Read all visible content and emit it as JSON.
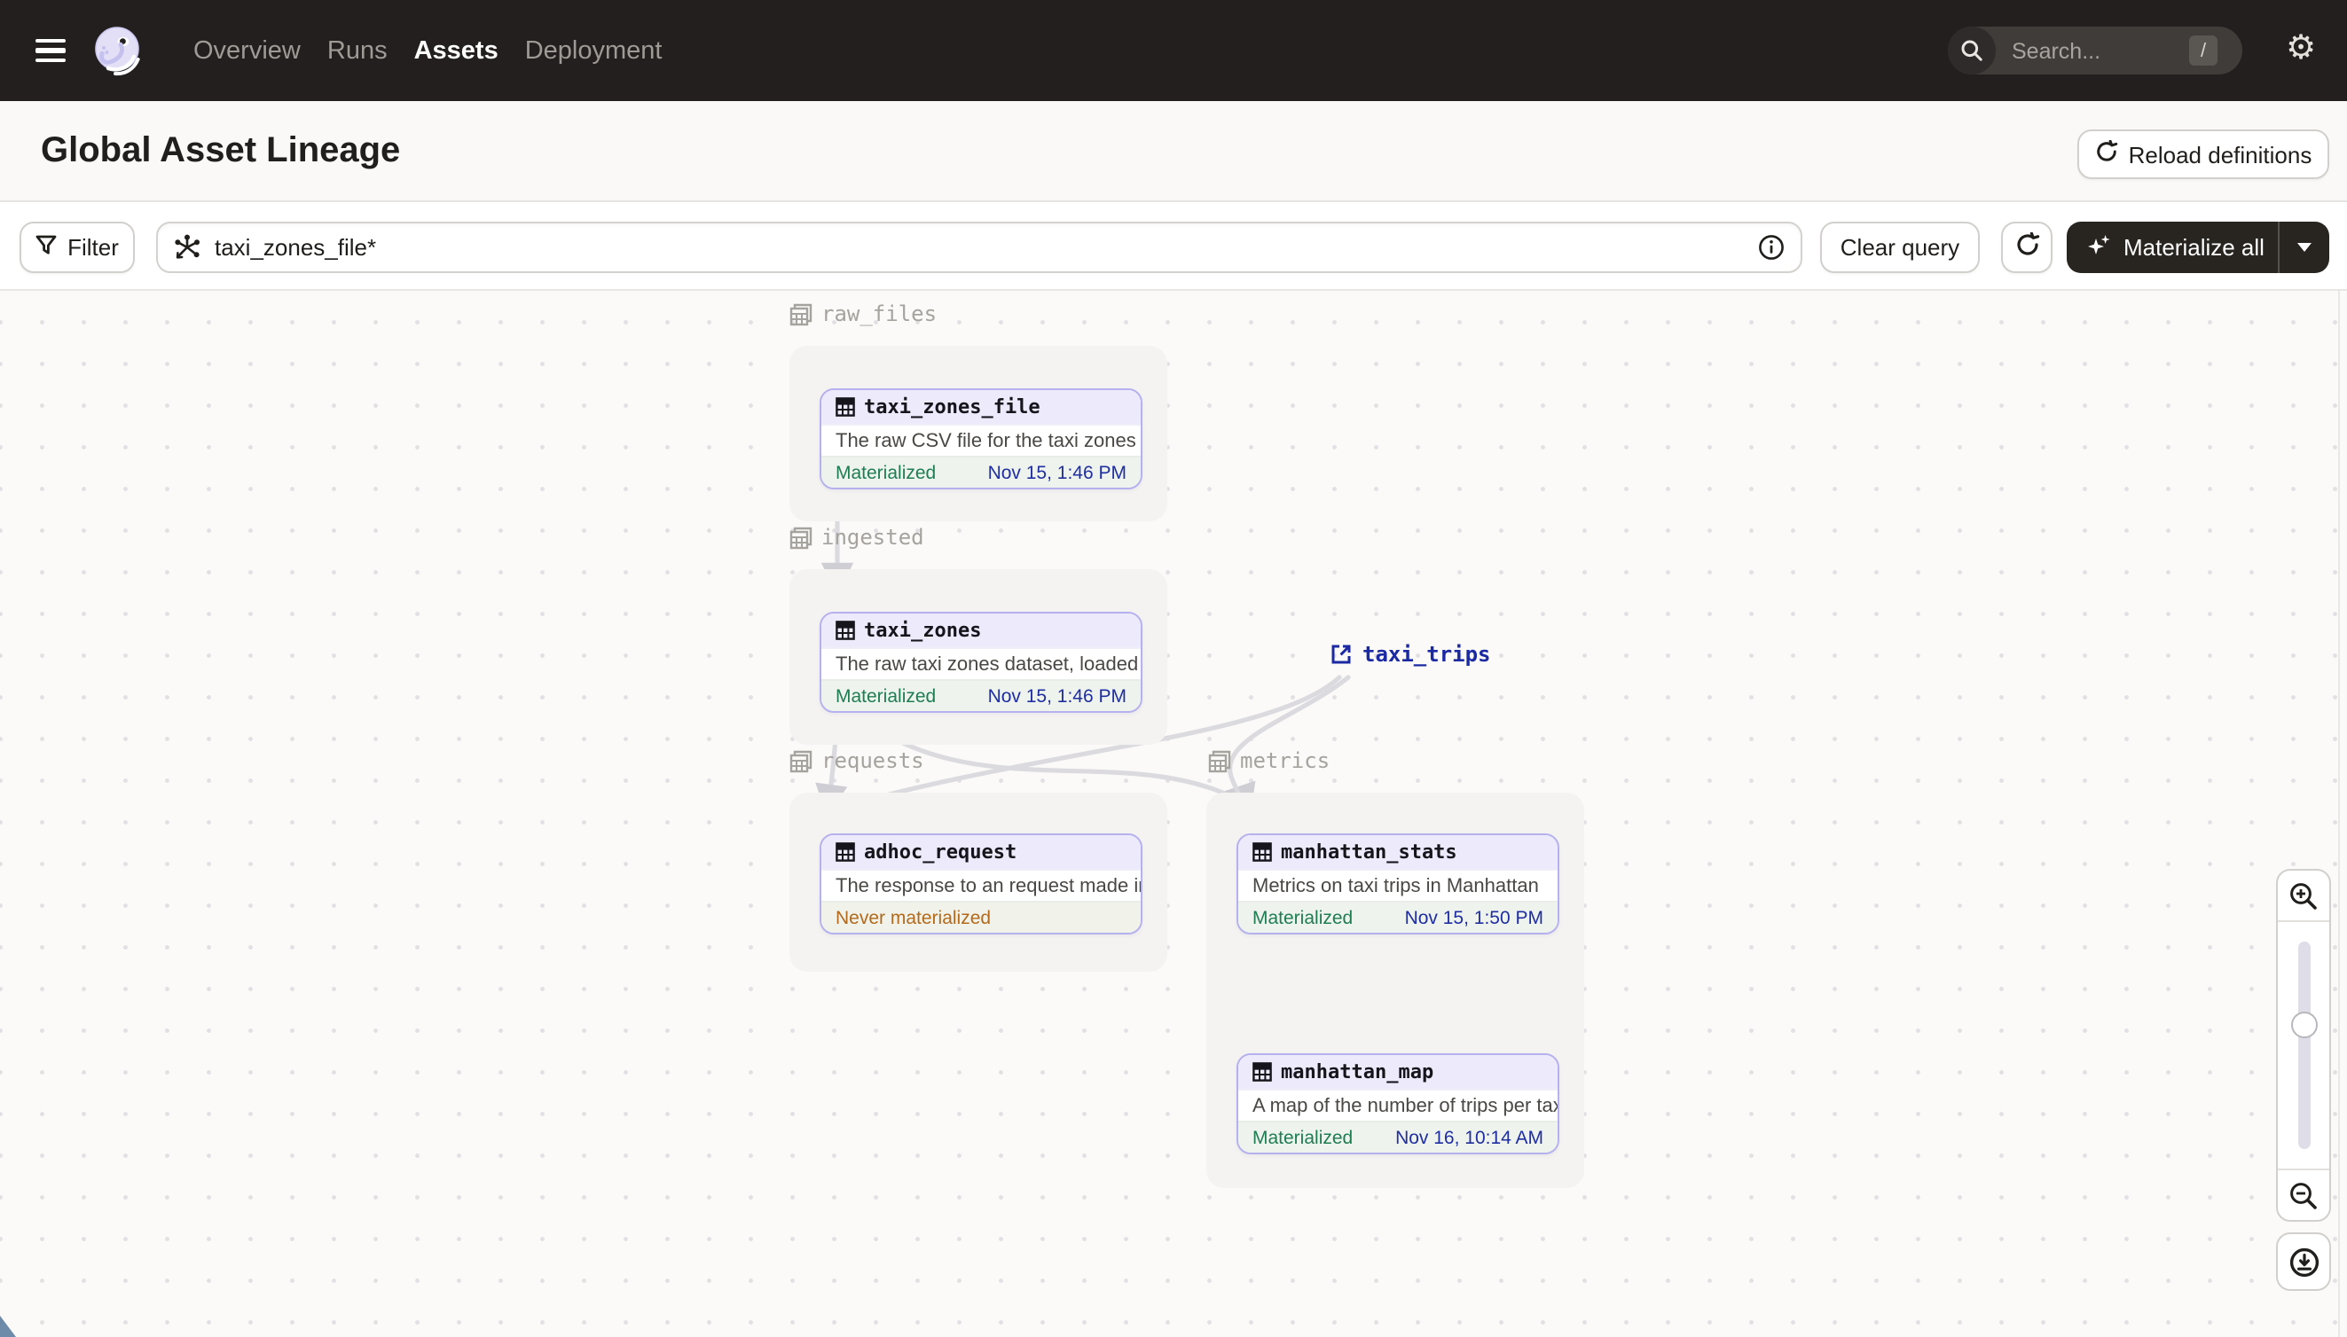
{
  "nav": {
    "links": [
      "Overview",
      "Runs",
      "Assets",
      "Deployment"
    ],
    "active_link": "Assets",
    "search_placeholder": "Search...",
    "search_shortcut": "/"
  },
  "header": {
    "title": "Global Asset Lineage",
    "reload_label": "Reload definitions"
  },
  "toolbar": {
    "filter_label": "Filter",
    "query_value": "taxi_zones_file*",
    "clear_label": "Clear query",
    "materialize_label": "Materialize all"
  },
  "graph": {
    "groups": [
      {
        "name": "raw_files"
      },
      {
        "name": "ingested"
      },
      {
        "name": "requests"
      },
      {
        "name": "metrics"
      }
    ],
    "nodes": [
      {
        "id": "taxi_zones_file",
        "group": "raw_files",
        "description": "The raw CSV file for the taxi zones dat...",
        "status": "Materialized",
        "timestamp": "Nov 15, 1:46 PM"
      },
      {
        "id": "taxi_zones",
        "group": "ingested",
        "description": "The raw taxi zones dataset, loaded int...",
        "status": "Materialized",
        "timestamp": "Nov 15, 1:46 PM"
      },
      {
        "id": "adhoc_request",
        "group": "requests",
        "description": "The response to an request made in th...",
        "status": "Never materialized",
        "timestamp": ""
      },
      {
        "id": "manhattan_stats",
        "group": "metrics",
        "description": "Metrics on taxi trips in Manhattan",
        "status": "Materialized",
        "timestamp": "Nov 15, 1:50 PM"
      },
      {
        "id": "manhattan_map",
        "group": "metrics",
        "description": "A map of the number of trips per taxi z...",
        "status": "Materialized",
        "timestamp": "Nov 16, 10:14 AM"
      }
    ],
    "external": [
      {
        "id": "taxi_trips"
      }
    ],
    "edges": [
      {
        "from": "taxi_zones_file",
        "to": "taxi_zones"
      },
      {
        "from": "taxi_zones",
        "to": "adhoc_request"
      },
      {
        "from": "taxi_zones",
        "to": "manhattan_stats"
      },
      {
        "from": "taxi_trips",
        "to": "adhoc_request"
      },
      {
        "from": "taxi_trips",
        "to": "manhattan_stats"
      },
      {
        "from": "manhattan_stats",
        "to": "manhattan_map"
      }
    ]
  },
  "colors": {
    "nav_bg": "#241F1F",
    "node_border": "#B5B0EE",
    "node_header_bg": "#ECEAFB",
    "materialized_green": "#1F7D52",
    "timestamp_navy": "#1F2EA0",
    "never_materialized_orange": "#B36A1C",
    "external_navy": "#1B2AA3",
    "edge_gray": "#DBDADE",
    "group_bg": "#F4F3F1"
  }
}
